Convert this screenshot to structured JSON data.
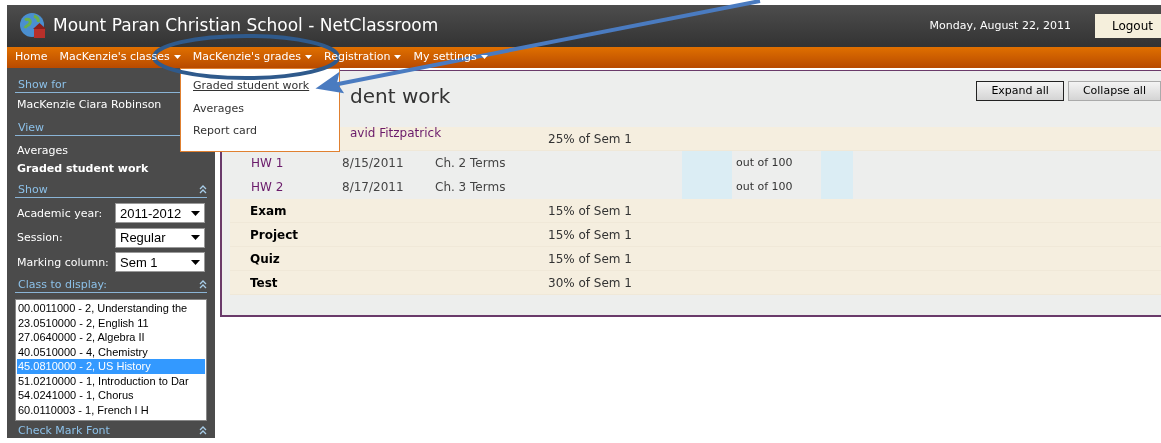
{
  "header": {
    "title": "Mount Paran Christian School - NetClassroom",
    "date": "Monday, August 22, 2011",
    "logout": "Logout"
  },
  "nav": [
    {
      "label": "Home",
      "dropdown": false
    },
    {
      "label": "MacKenzie's classes",
      "dropdown": true
    },
    {
      "label": "MacKenzie's grades",
      "dropdown": true
    },
    {
      "label": "Registration",
      "dropdown": true
    },
    {
      "label": "My settings",
      "dropdown": true
    }
  ],
  "menu": [
    {
      "label": "Graded student work",
      "selected": true
    },
    {
      "label": "Averages",
      "selected": false
    },
    {
      "label": "Report card",
      "selected": false
    }
  ],
  "sidebar": [
    {
      "kind": "text",
      "heading": "Show for",
      "text": "MacKenzie Ciara Robinson"
    },
    {
      "kind": "links",
      "heading": "View",
      "collapsible": false,
      "items": [
        {
          "label": "Averages",
          "selected": false
        },
        {
          "label": "Graded student work",
          "selected": true
        }
      ]
    },
    {
      "kind": "fields",
      "heading": "Show",
      "collapsible": true,
      "fields": [
        {
          "label": "Academic year:",
          "value": "2011-2012"
        },
        {
          "label": "Session:",
          "value": "Regular"
        },
        {
          "label": "Marking column:",
          "value": "Sem 1"
        }
      ]
    },
    {
      "kind": "listbox",
      "heading": "Class to display:",
      "collapsible": true,
      "items": [
        {
          "label": "00.0011000 - 2, Understanding the",
          "selected": false
        },
        {
          "label": "23.0510000 - 2, English 11",
          "selected": false
        },
        {
          "label": "27.0640000 - 2, Algebra II",
          "selected": false
        },
        {
          "label": "40.0510000 - 4, Chemistry",
          "selected": false
        },
        {
          "label": "45.0810000 - 2, US History",
          "selected": true
        },
        {
          "label": "51.0210000 - 1, Introduction to Dar",
          "selected": false
        },
        {
          "label": "54.0241000 - 1, Chorus",
          "selected": false
        },
        {
          "label": "60.0110003 - 1, French I H",
          "selected": false
        }
      ]
    },
    {
      "kind": "heading",
      "heading": "Check Mark Font",
      "collapsible": true
    }
  ],
  "main": {
    "title": "dent work",
    "teacher": "avid Fitzpatrick",
    "buttons": [
      {
        "label": "Expand all",
        "focused": true
      },
      {
        "label": "Collapse all",
        "focused": false
      }
    ],
    "rows": [
      {
        "kind": "category",
        "weight": "25% of Sem 1"
      },
      {
        "kind": "item",
        "name": "HW 1",
        "date": "8/15/2011",
        "description": "Ch. 2 Terms",
        "out_of": "out of 100"
      },
      {
        "kind": "item",
        "name": "HW 2",
        "date": "8/17/2011",
        "description": "Ch. 3 Terms",
        "out_of": "out of 100"
      },
      {
        "kind": "category",
        "name": "Exam",
        "weight": "15% of Sem 1"
      },
      {
        "kind": "category",
        "name": "Project",
        "weight": "15% of Sem 1"
      },
      {
        "kind": "category",
        "name": "Quiz",
        "weight": "15% of Sem 1"
      },
      {
        "kind": "category",
        "name": "Test",
        "weight": "30% of Sem 1"
      }
    ]
  }
}
